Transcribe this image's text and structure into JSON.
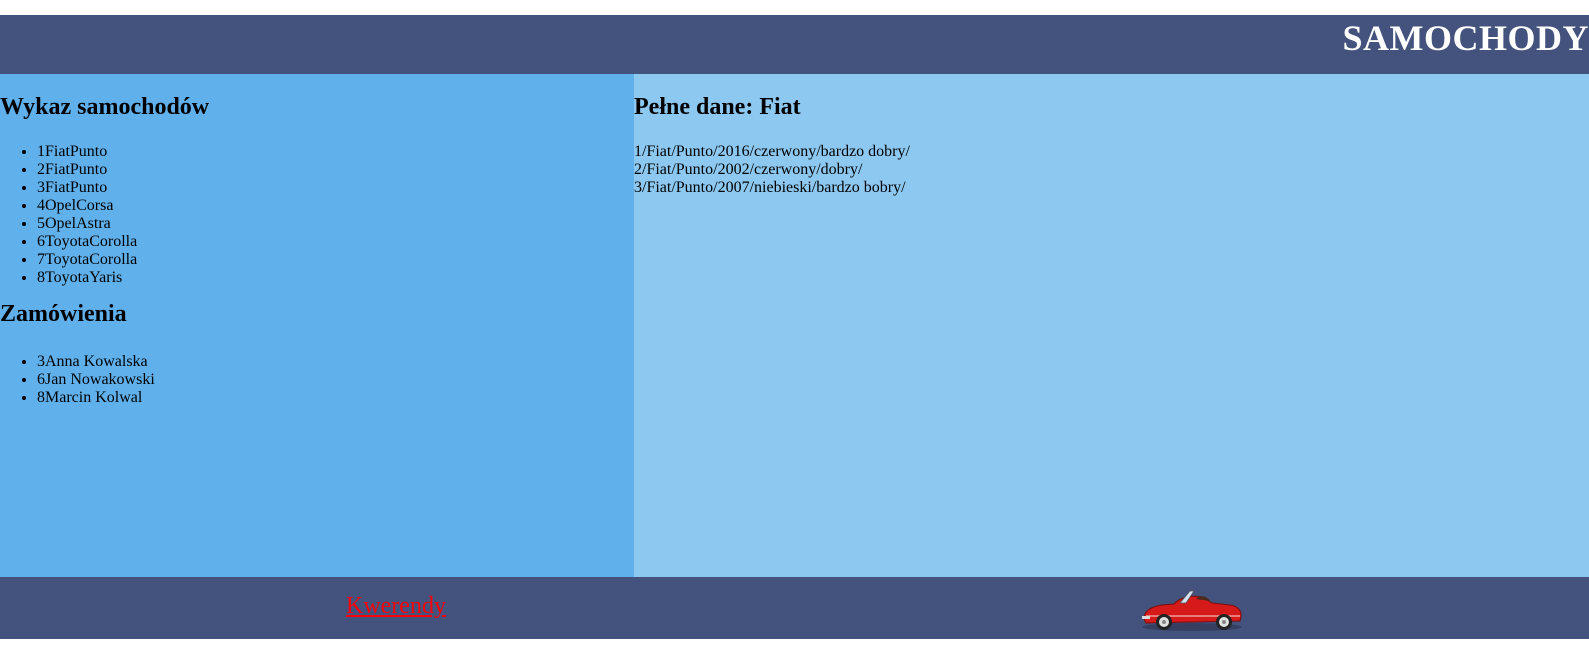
{
  "header": {
    "title": "SAMOCHODY"
  },
  "left": {
    "cars_title": "Wykaz samochodów",
    "cars": [
      "1FiatPunto",
      "2FiatPunto",
      "3FiatPunto",
      "4OpelCorsa",
      "5OpelAstra",
      "6ToyotaCorolla",
      "7ToyotaCorolla",
      "8ToyotaYaris"
    ],
    "orders_title": "Zamówienia",
    "orders": [
      "3Anna Kowalska",
      "6Jan Nowakowski",
      "8Marcin Kolwal"
    ]
  },
  "right": {
    "details_title": "Pełne dane: Fiat",
    "details": [
      "1/Fiat/Punto/2016/czerwony/bardzo dobry/",
      "2/Fiat/Punto/2002/czerwony/dobry/",
      "3/Fiat/Punto/2007/niebieski/bardzo bobry/"
    ]
  },
  "footer": {
    "link_label": "Kwerendy",
    "image_icon": "red-convertible-car-icon"
  },
  "colors": {
    "header_bg": "#44527e",
    "left_bg": "#60b0eb",
    "right_bg": "#8dc8f1",
    "footer_bg": "#44527e",
    "link": "#ff0000",
    "car": "#d61a1a"
  }
}
